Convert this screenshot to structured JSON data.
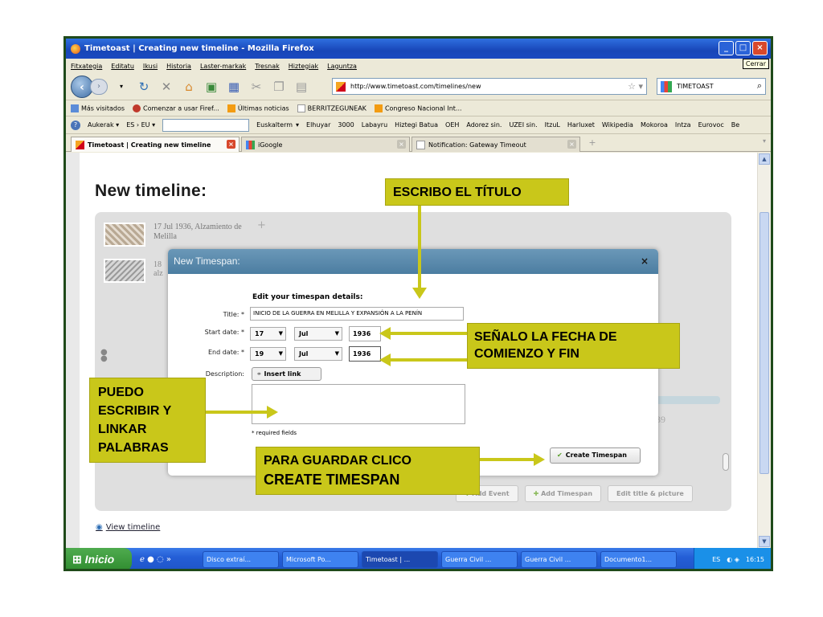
{
  "window": {
    "title": "Timetoast | Creating new timeline - Mozilla Firefox",
    "cerrar_tooltip": "Cerrar"
  },
  "menubar": [
    "Fitxategia",
    "Editatu",
    "Ikusi",
    "Historia",
    "Laster-markak",
    "Tresnak",
    "Hiztegiak",
    "Laguntza"
  ],
  "navbar": {
    "url": "http://www.timetoast.com/timelines/new",
    "search_engine": "TIMETOAST"
  },
  "bookmarks": [
    "Más visitados",
    "Comenzar a usar Firef...",
    "Últimas noticias",
    "BERRITZEGUNEAK",
    "Congreso Nacional Int..."
  ],
  "addonbar": {
    "aukerak": "Aukerak",
    "lang": "ES › EU",
    "links": [
      "Euskalterm",
      "Elhuyar",
      "3000",
      "Labayru",
      "Hiztegi Batua",
      "OEH",
      "Adorez sin.",
      "UZEI sin.",
      "ItzuL",
      "Harluxet",
      "Wikipedia",
      "Mokoroa",
      "Intza",
      "Eurovoc",
      "Be"
    ]
  },
  "tabs": [
    {
      "label": "Timetoast | Creating new timeline",
      "active": true
    },
    {
      "label": "iGoogle",
      "active": false
    },
    {
      "label": "Notification: Gateway Timeout",
      "active": false
    }
  ],
  "page": {
    "heading": "New timeline:",
    "event1": "17 Jul 1936, Alzamiento de Melilla",
    "event2": "18",
    "event2_sub": "alz",
    "tick_label": "39",
    "buttons": [
      "Add Event",
      "Add Timespan",
      "Edit title & picture"
    ],
    "view_link": "View timeline"
  },
  "modal": {
    "title": "New Timespan:",
    "close": "×",
    "heading": "Edit your timespan details:",
    "title_label": "Title: *",
    "title_value": "INICIO DE LA GUERRA EN MELILLA Y EXPANSIÓN A LA PENÍN",
    "start_label": "Start date: *",
    "start_day": "17",
    "start_month": "Jul",
    "start_year": "1936",
    "end_label": "End date: *",
    "end_day": "19",
    "end_month": "Jul",
    "end_year": "1936",
    "desc_label": "Description:",
    "insert_link": "Insert link",
    "required": "* required fields",
    "create": "Create Timespan"
  },
  "annotations": {
    "title_note": "ESCRIBO EL TÍTULO",
    "date_note": "SEÑALO LA FECHA DE COMIENZO Y FIN",
    "desc_note": "PUEDO ESCRIBIR Y LINKAR PALABRAS",
    "save_note_1": "PARA GUARDAR CLICO",
    "save_note_2": "CREATE TIMESPAN",
    "color": "#c9c71a"
  },
  "taskbar": {
    "start": "Inicio",
    "tasks": [
      "Disco extraí...",
      "Microsoft Po...",
      "Timetoast | ...",
      "Guerra Civil ...",
      "Guerra Civil ...",
      "Documento1..."
    ],
    "lang": "ES",
    "clock": "16:15"
  }
}
